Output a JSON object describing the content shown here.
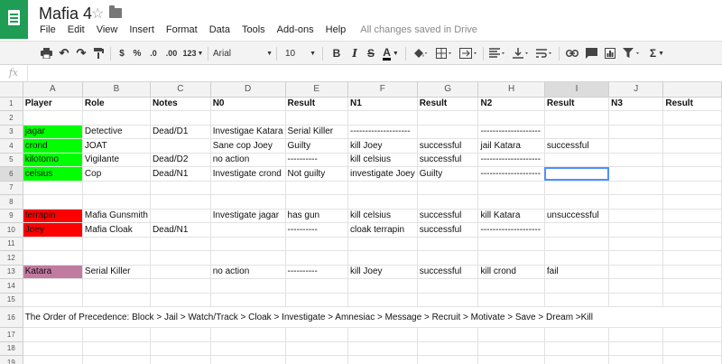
{
  "app": {
    "title": "Mafia 4",
    "star_icon": "star-icon",
    "folder_icon": "folder-icon",
    "logo_icon": "sheets-logo-icon",
    "save_status": "All changes saved in Drive",
    "menu": [
      "File",
      "Edit",
      "View",
      "Insert",
      "Format",
      "Data",
      "Tools",
      "Add-ons",
      "Help"
    ]
  },
  "toolbar": {
    "currency": "$",
    "percent": "%",
    "decrease_decimal": ".0",
    "increase_decimal": ".00",
    "more_formats": "123",
    "font": "Arial",
    "font_size": "10",
    "bold": "B",
    "italic": "I",
    "strike": "S",
    "text_color": "A",
    "sum": "Σ"
  },
  "formula_bar": {
    "label": "fx",
    "value": ""
  },
  "grid": {
    "columns": [
      "A",
      "B",
      "C",
      "D",
      "E",
      "F",
      "G",
      "H",
      "I",
      "J",
      ""
    ],
    "selected_cell": "I6",
    "colors": {
      "green": "#00ff00",
      "red": "#ff0000",
      "pink": "#c27ba0",
      "selection": "#4d90fe"
    },
    "rows": [
      {
        "n": "1",
        "cells": [
          "Player",
          "Role",
          "Notes",
          "N0",
          "Result",
          "N1",
          "Result",
          "N2",
          "Result",
          "N3",
          "Result"
        ]
      },
      {
        "n": "2",
        "cells": [
          "",
          "",
          "",
          "",
          "",
          "",
          "",
          "",
          "",
          "",
          ""
        ]
      },
      {
        "n": "3",
        "cells": [
          "jagar",
          "Detective",
          "Dead/D1",
          "Investigae Katara",
          "Serial Killer",
          "--------------------",
          "",
          "--------------------",
          "",
          "",
          ""
        ]
      },
      {
        "n": "4",
        "cells": [
          "crond",
          "JOAT",
          "",
          "Sane cop Joey",
          "Guilty",
          "kill Joey",
          "successful",
          "jail Katara",
          "successful",
          "",
          ""
        ]
      },
      {
        "n": "5",
        "cells": [
          "kilotomo",
          "Vigilante",
          "Dead/D2",
          "no action",
          "----------",
          "kill celsius",
          "successful",
          "--------------------",
          "",
          "",
          ""
        ]
      },
      {
        "n": "6",
        "cells": [
          "celsius",
          "Cop",
          "Dead/N1",
          "Investigate crond",
          "Not guilty",
          "investigate Joey",
          "Guilty",
          "--------------------",
          "",
          "",
          ""
        ]
      },
      {
        "n": "7",
        "cells": [
          "",
          "",
          "",
          "",
          "",
          "",
          "",
          "",
          "",
          "",
          ""
        ]
      },
      {
        "n": "8",
        "cells": [
          "",
          "",
          "",
          "",
          "",
          "",
          "",
          "",
          "",
          "",
          ""
        ]
      },
      {
        "n": "9",
        "cells": [
          "terrapin",
          "Mafia Gunsmith",
          "",
          "Investigate jagar",
          "has gun",
          "kill celsius",
          "successful",
          "kill Katara",
          "unsuccessful",
          "",
          ""
        ]
      },
      {
        "n": "10",
        "cells": [
          "Joey",
          "Mafia Cloak",
          "Dead/N1",
          "",
          "----------",
          "cloak terrapin",
          "successful",
          "--------------------",
          "",
          "",
          ""
        ]
      },
      {
        "n": "11",
        "cells": [
          "",
          "",
          "",
          "",
          "",
          "",
          "",
          "",
          "",
          "",
          ""
        ]
      },
      {
        "n": "12",
        "cells": [
          "",
          "",
          "",
          "",
          "",
          "",
          "",
          "",
          "",
          "",
          ""
        ]
      },
      {
        "n": "13",
        "cells": [
          "Katara",
          "Serial Killer",
          "",
          "no action",
          "----------",
          "kill Joey",
          "successful",
          "kill crond",
          "fail",
          "",
          ""
        ]
      },
      {
        "n": "14",
        "cells": [
          "",
          "",
          "",
          "",
          "",
          "",
          "",
          "",
          "",
          "",
          ""
        ]
      },
      {
        "n": "15",
        "cells": [
          "",
          "",
          "",
          "",
          "",
          "",
          "",
          "",
          "",
          "",
          ""
        ]
      },
      {
        "n": "16",
        "precedence": "The Order of Precedence: Block > Jail > Watch/Track > Cloak > Investigate > Amnesiac > Message > Recruit > Motivate > Save > Dream >Kill"
      },
      {
        "n": "17",
        "cells": [
          "",
          "",
          "",
          "",
          "",
          "",
          "",
          "",
          "",
          "",
          ""
        ]
      },
      {
        "n": "18",
        "cells": [
          "",
          "",
          "",
          "",
          "",
          "",
          "",
          "",
          "",
          "",
          ""
        ]
      },
      {
        "n": "19",
        "cells": [
          "",
          "",
          "",
          "",
          "",
          "",
          "",
          "",
          "",
          "",
          ""
        ]
      }
    ]
  }
}
